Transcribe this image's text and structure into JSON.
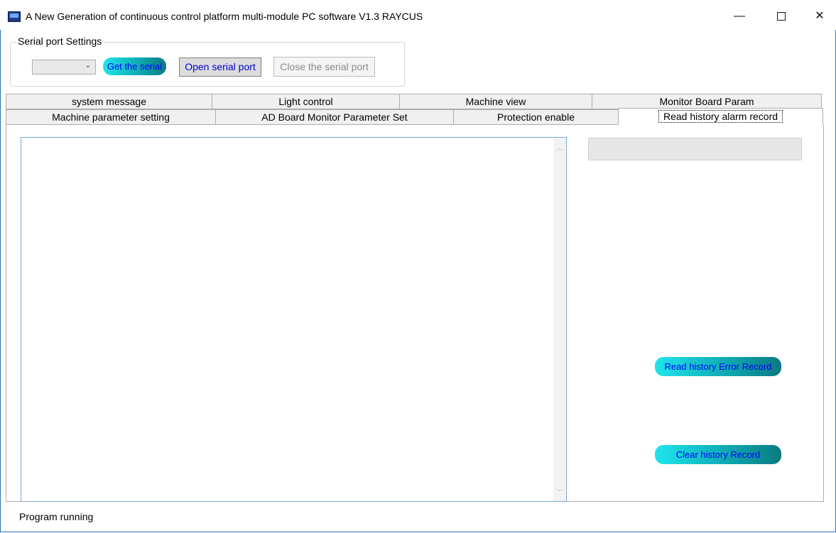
{
  "window": {
    "title": "A New Generation of continuous control platform multi-module PC software V1.3 RAYCUS",
    "minimize_glyph": "—",
    "close_glyph": "✕"
  },
  "serial": {
    "group_label": "Serial port Settings",
    "port_value": "",
    "get_label": "Get the serial",
    "open_label": "Open serial port",
    "close_label": "Close the serial port"
  },
  "tabs": {
    "row1": [
      "system message",
      "Light control",
      "Machine view",
      "Monitor Board Param"
    ],
    "row2": [
      "Machine parameter setting",
      "AD Board Monitor Parameter Set",
      "Protection enable",
      "Read history alarm record"
    ],
    "active": "Read history alarm record"
  },
  "panel": {
    "record_text": "",
    "info_value": "",
    "read_label": "Read history Error Record",
    "clear_label": "Clear history Record"
  },
  "status": {
    "text": "Program running"
  },
  "colors": {
    "accent_border": "#2b6fbf",
    "pill_light": "#1fe6ec",
    "pill_dark": "#0a7a80",
    "link_text": "#0000ff"
  }
}
